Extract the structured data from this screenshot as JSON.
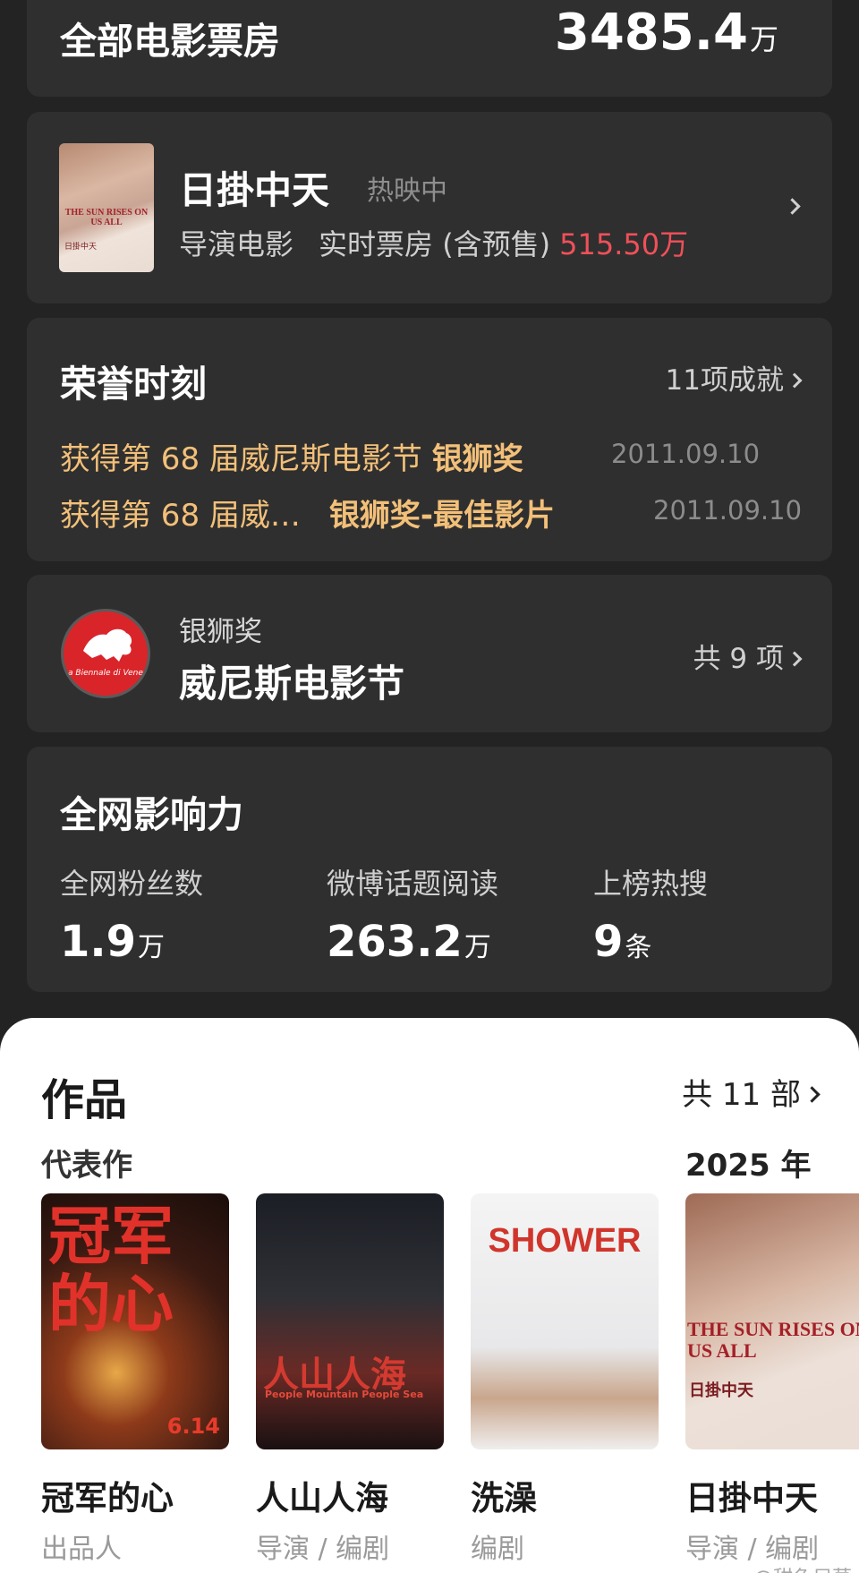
{
  "box_office": {
    "label": "全部电影票房",
    "value": "3485.4",
    "unit": "万"
  },
  "current_film": {
    "title": "日掛中天",
    "status": "热映中",
    "type": "导演电影",
    "gross_label": "实时票房 (含预售)",
    "gross_value": "515.50万",
    "poster_text": "THE SUN RISES ON US ALL",
    "poster_cn": "日掛中天"
  },
  "honors": {
    "title": "荣誉时刻",
    "more_label": "11项成就",
    "items": [
      {
        "prefix": "获得第 68 届威尼斯电影节",
        "award": "银狮奖",
        "date": "2011.09.10"
      },
      {
        "prefix": "获得第 68 届威…",
        "award": "银狮奖-最佳影片",
        "date": "2011.09.10"
      }
    ]
  },
  "festival": {
    "award": "银狮奖",
    "name": "威尼斯电影节",
    "count_label": "共 9 项",
    "logo_text": "La Biennale di Venezia"
  },
  "influence": {
    "title": "全网影响力",
    "stats": [
      {
        "label": "全网粉丝数",
        "value": "1.9",
        "unit": "万"
      },
      {
        "label": "微博话题阅读",
        "value": "263.2",
        "unit": "万"
      },
      {
        "label": "上榜热搜",
        "value": "9",
        "unit": "条"
      }
    ]
  },
  "works": {
    "title": "作品",
    "count_label": "共 11 部",
    "subtitle": "代表作",
    "year_label": "2025 年",
    "items": [
      {
        "title": "冠军的心",
        "role": "出品人",
        "poster_title": "冠军的心",
        "poster_date": "6.14"
      },
      {
        "title": "人山人海",
        "role": "导演 / 编剧",
        "poster_title": "人山人海",
        "poster_en": "People Mountain People Sea"
      },
      {
        "title": "洗澡",
        "role": "编剧",
        "poster_title": "SHOWER"
      },
      {
        "title": "日掛中天",
        "role": "导演 / 编剧",
        "poster_title": "THE SUN RISES ON US ALL",
        "poster_cn": "日掛中天"
      }
    ]
  },
  "watermark": "@甜鱼尼莫"
}
